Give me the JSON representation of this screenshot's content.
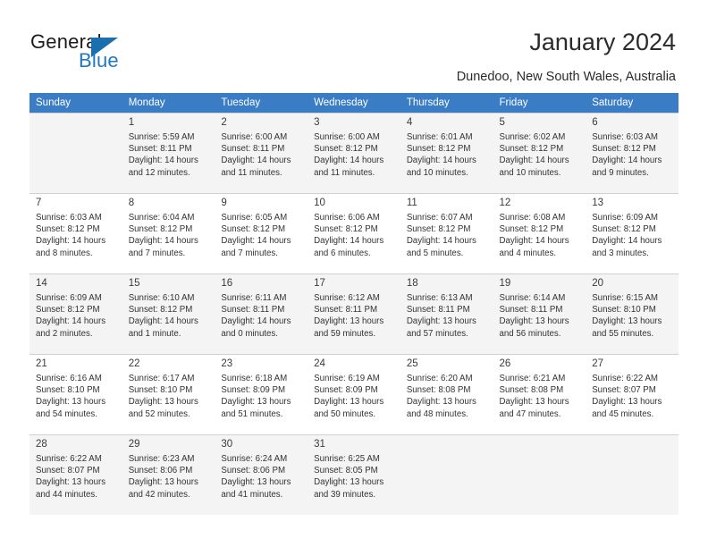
{
  "brand": {
    "name_part1": "General",
    "name_part2": "Blue",
    "accent_color": "#1f78c1"
  },
  "header": {
    "title": "January 2024",
    "subtitle": "Dunedoo, New South Wales, Australia"
  },
  "calendar": {
    "header_bg": "#3b7dc4",
    "weekday_headers": [
      "Sunday",
      "Monday",
      "Tuesday",
      "Wednesday",
      "Thursday",
      "Friday",
      "Saturday"
    ],
    "weeks": [
      [
        {
          "day": "",
          "sunrise": "",
          "sunset": "",
          "daylight1": "",
          "daylight2": "",
          "empty": true
        },
        {
          "day": "1",
          "sunrise": "Sunrise: 5:59 AM",
          "sunset": "Sunset: 8:11 PM",
          "daylight1": "Daylight: 14 hours",
          "daylight2": "and 12 minutes."
        },
        {
          "day": "2",
          "sunrise": "Sunrise: 6:00 AM",
          "sunset": "Sunset: 8:11 PM",
          "daylight1": "Daylight: 14 hours",
          "daylight2": "and 11 minutes."
        },
        {
          "day": "3",
          "sunrise": "Sunrise: 6:00 AM",
          "sunset": "Sunset: 8:12 PM",
          "daylight1": "Daylight: 14 hours",
          "daylight2": "and 11 minutes."
        },
        {
          "day": "4",
          "sunrise": "Sunrise: 6:01 AM",
          "sunset": "Sunset: 8:12 PM",
          "daylight1": "Daylight: 14 hours",
          "daylight2": "and 10 minutes."
        },
        {
          "day": "5",
          "sunrise": "Sunrise: 6:02 AM",
          "sunset": "Sunset: 8:12 PM",
          "daylight1": "Daylight: 14 hours",
          "daylight2": "and 10 minutes."
        },
        {
          "day": "6",
          "sunrise": "Sunrise: 6:03 AM",
          "sunset": "Sunset: 8:12 PM",
          "daylight1": "Daylight: 14 hours",
          "daylight2": "and 9 minutes."
        }
      ],
      [
        {
          "day": "7",
          "sunrise": "Sunrise: 6:03 AM",
          "sunset": "Sunset: 8:12 PM",
          "daylight1": "Daylight: 14 hours",
          "daylight2": "and 8 minutes."
        },
        {
          "day": "8",
          "sunrise": "Sunrise: 6:04 AM",
          "sunset": "Sunset: 8:12 PM",
          "daylight1": "Daylight: 14 hours",
          "daylight2": "and 7 minutes."
        },
        {
          "day": "9",
          "sunrise": "Sunrise: 6:05 AM",
          "sunset": "Sunset: 8:12 PM",
          "daylight1": "Daylight: 14 hours",
          "daylight2": "and 7 minutes."
        },
        {
          "day": "10",
          "sunrise": "Sunrise: 6:06 AM",
          "sunset": "Sunset: 8:12 PM",
          "daylight1": "Daylight: 14 hours",
          "daylight2": "and 6 minutes."
        },
        {
          "day": "11",
          "sunrise": "Sunrise: 6:07 AM",
          "sunset": "Sunset: 8:12 PM",
          "daylight1": "Daylight: 14 hours",
          "daylight2": "and 5 minutes."
        },
        {
          "day": "12",
          "sunrise": "Sunrise: 6:08 AM",
          "sunset": "Sunset: 8:12 PM",
          "daylight1": "Daylight: 14 hours",
          "daylight2": "and 4 minutes."
        },
        {
          "day": "13",
          "sunrise": "Sunrise: 6:09 AM",
          "sunset": "Sunset: 8:12 PM",
          "daylight1": "Daylight: 14 hours",
          "daylight2": "and 3 minutes."
        }
      ],
      [
        {
          "day": "14",
          "sunrise": "Sunrise: 6:09 AM",
          "sunset": "Sunset: 8:12 PM",
          "daylight1": "Daylight: 14 hours",
          "daylight2": "and 2 minutes."
        },
        {
          "day": "15",
          "sunrise": "Sunrise: 6:10 AM",
          "sunset": "Sunset: 8:12 PM",
          "daylight1": "Daylight: 14 hours",
          "daylight2": "and 1 minute."
        },
        {
          "day": "16",
          "sunrise": "Sunrise: 6:11 AM",
          "sunset": "Sunset: 8:11 PM",
          "daylight1": "Daylight: 14 hours",
          "daylight2": "and 0 minutes."
        },
        {
          "day": "17",
          "sunrise": "Sunrise: 6:12 AM",
          "sunset": "Sunset: 8:11 PM",
          "daylight1": "Daylight: 13 hours",
          "daylight2": "and 59 minutes."
        },
        {
          "day": "18",
          "sunrise": "Sunrise: 6:13 AM",
          "sunset": "Sunset: 8:11 PM",
          "daylight1": "Daylight: 13 hours",
          "daylight2": "and 57 minutes."
        },
        {
          "day": "19",
          "sunrise": "Sunrise: 6:14 AM",
          "sunset": "Sunset: 8:11 PM",
          "daylight1": "Daylight: 13 hours",
          "daylight2": "and 56 minutes."
        },
        {
          "day": "20",
          "sunrise": "Sunrise: 6:15 AM",
          "sunset": "Sunset: 8:10 PM",
          "daylight1": "Daylight: 13 hours",
          "daylight2": "and 55 minutes."
        }
      ],
      [
        {
          "day": "21",
          "sunrise": "Sunrise: 6:16 AM",
          "sunset": "Sunset: 8:10 PM",
          "daylight1": "Daylight: 13 hours",
          "daylight2": "and 54 minutes."
        },
        {
          "day": "22",
          "sunrise": "Sunrise: 6:17 AM",
          "sunset": "Sunset: 8:10 PM",
          "daylight1": "Daylight: 13 hours",
          "daylight2": "and 52 minutes."
        },
        {
          "day": "23",
          "sunrise": "Sunrise: 6:18 AM",
          "sunset": "Sunset: 8:09 PM",
          "daylight1": "Daylight: 13 hours",
          "daylight2": "and 51 minutes."
        },
        {
          "day": "24",
          "sunrise": "Sunrise: 6:19 AM",
          "sunset": "Sunset: 8:09 PM",
          "daylight1": "Daylight: 13 hours",
          "daylight2": "and 50 minutes."
        },
        {
          "day": "25",
          "sunrise": "Sunrise: 6:20 AM",
          "sunset": "Sunset: 8:08 PM",
          "daylight1": "Daylight: 13 hours",
          "daylight2": "and 48 minutes."
        },
        {
          "day": "26",
          "sunrise": "Sunrise: 6:21 AM",
          "sunset": "Sunset: 8:08 PM",
          "daylight1": "Daylight: 13 hours",
          "daylight2": "and 47 minutes."
        },
        {
          "day": "27",
          "sunrise": "Sunrise: 6:22 AM",
          "sunset": "Sunset: 8:07 PM",
          "daylight1": "Daylight: 13 hours",
          "daylight2": "and 45 minutes."
        }
      ],
      [
        {
          "day": "28",
          "sunrise": "Sunrise: 6:22 AM",
          "sunset": "Sunset: 8:07 PM",
          "daylight1": "Daylight: 13 hours",
          "daylight2": "and 44 minutes."
        },
        {
          "day": "29",
          "sunrise": "Sunrise: 6:23 AM",
          "sunset": "Sunset: 8:06 PM",
          "daylight1": "Daylight: 13 hours",
          "daylight2": "and 42 minutes."
        },
        {
          "day": "30",
          "sunrise": "Sunrise: 6:24 AM",
          "sunset": "Sunset: 8:06 PM",
          "daylight1": "Daylight: 13 hours",
          "daylight2": "and 41 minutes."
        },
        {
          "day": "31",
          "sunrise": "Sunrise: 6:25 AM",
          "sunset": "Sunset: 8:05 PM",
          "daylight1": "Daylight: 13 hours",
          "daylight2": "and 39 minutes."
        },
        {
          "day": "",
          "sunrise": "",
          "sunset": "",
          "daylight1": "",
          "daylight2": "",
          "empty": true
        },
        {
          "day": "",
          "sunrise": "",
          "sunset": "",
          "daylight1": "",
          "daylight2": "",
          "empty": true
        },
        {
          "day": "",
          "sunrise": "",
          "sunset": "",
          "daylight1": "",
          "daylight2": "",
          "empty": true
        }
      ]
    ]
  }
}
